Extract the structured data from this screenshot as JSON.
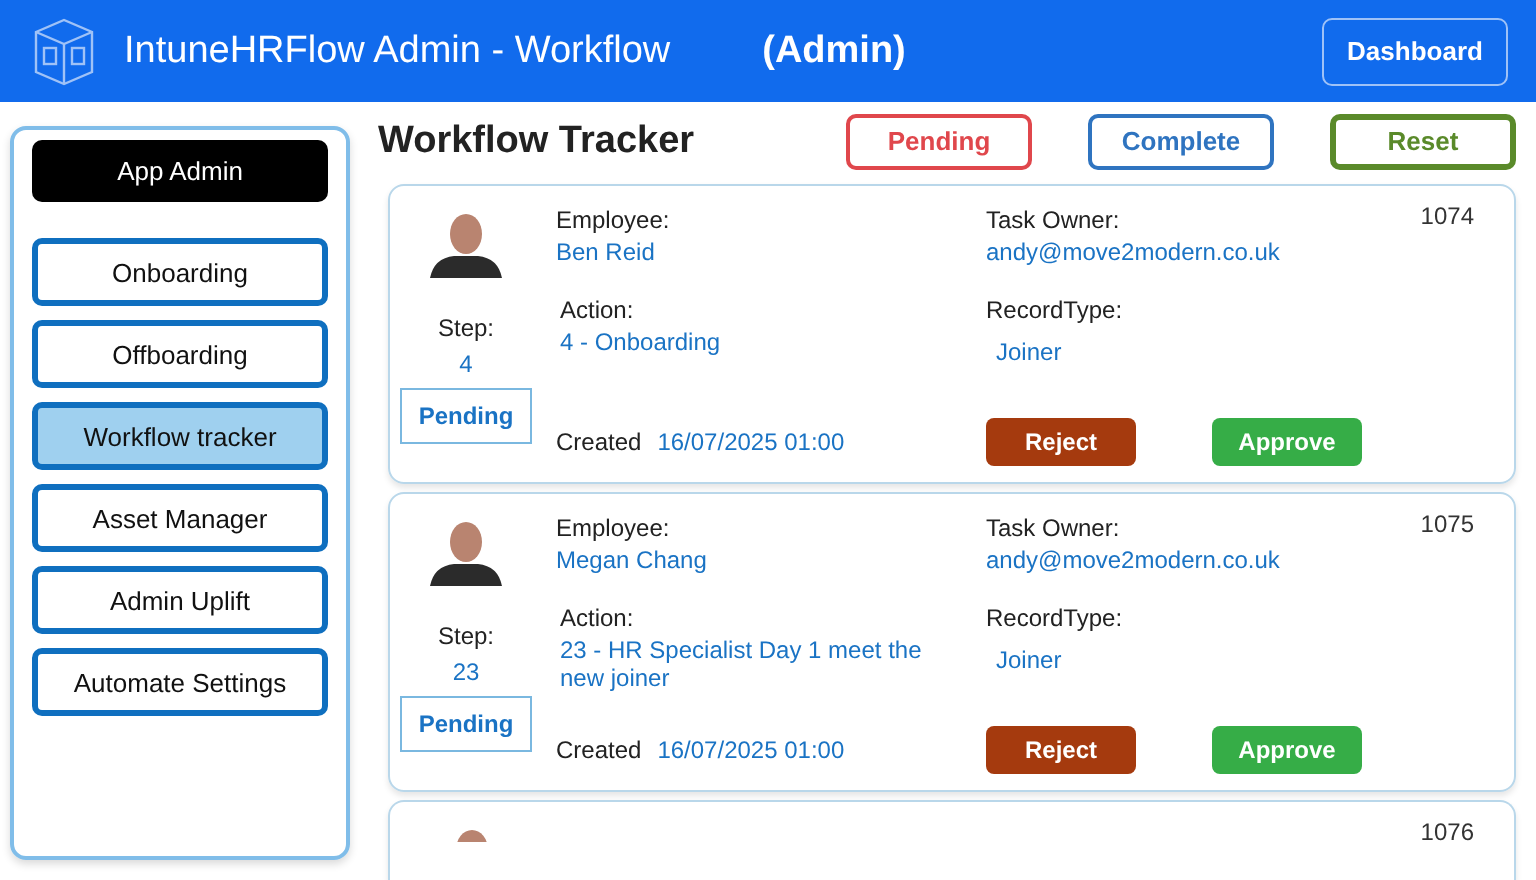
{
  "header": {
    "title": "IntuneHRFlow Admin - Workflow",
    "role": "(Admin)",
    "button": "Dashboard"
  },
  "sidebar": {
    "heading": "App Admin",
    "items": [
      {
        "label": "Onboarding",
        "selected": false
      },
      {
        "label": "Offboarding",
        "selected": false
      },
      {
        "label": "Workflow tracker",
        "selected": true
      },
      {
        "label": "Asset Manager",
        "selected": false
      },
      {
        "label": "Admin Uplift",
        "selected": false
      },
      {
        "label": "Automate Settings",
        "selected": false
      }
    ]
  },
  "main": {
    "title": "Workflow Tracker",
    "filters": [
      {
        "label": "Pending",
        "color": "#e0474c"
      },
      {
        "label": "Complete",
        "color": "#2f74c0"
      },
      {
        "label": "Reset",
        "color": "#5a8a2a"
      }
    ],
    "cards": [
      {
        "kind": "full",
        "id": "1074",
        "employee_label": "Employee:",
        "employee": "Ben Reid",
        "owner_label": "Task Owner:",
        "owner": "andy@move2modern.co.uk",
        "step_label": "Step:",
        "step": "4",
        "action_label": "Action:",
        "action": "4 - Onboarding",
        "record_label": "RecordType:",
        "record_type": "Joiner",
        "status": "Pending",
        "created_label": "Created",
        "created": "16/07/2025 01:00",
        "reject": "Reject",
        "approve": "Approve"
      },
      {
        "kind": "full",
        "id": "1075",
        "employee_label": "Employee:",
        "employee": "Megan Chang",
        "owner_label": "Task Owner:",
        "owner": "andy@move2modern.co.uk",
        "step_label": "Step:",
        "step": "23",
        "action_label": "Action:",
        "action": "23 - HR Specialist Day 1 meet the new joiner",
        "record_label": "RecordType:",
        "record_type": "Joiner",
        "status": "Pending",
        "created_label": "Created",
        "created": "16/07/2025 01:00",
        "reject": "Reject",
        "approve": "Approve"
      },
      {
        "kind": "partial",
        "id": "1076"
      }
    ]
  }
}
